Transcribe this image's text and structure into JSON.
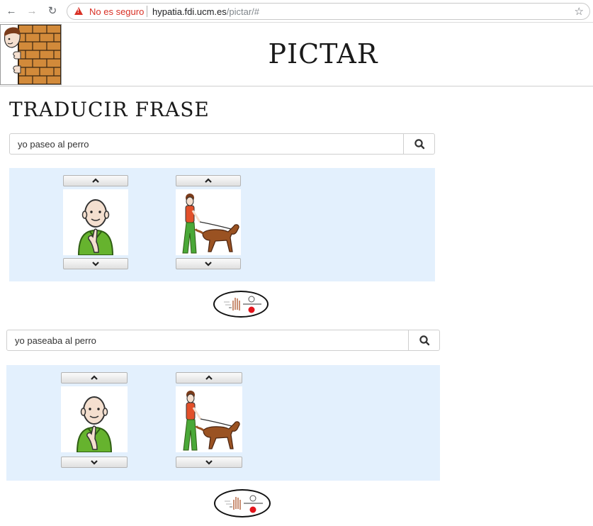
{
  "browser": {
    "security_label": "No es seguro",
    "url_host": "hypatia.fdi.ucm.es",
    "url_path": "/pictar/#",
    "back_icon": "arrow-left-icon",
    "forward_icon": "arrow-right-icon",
    "reload_icon": "reload-icon",
    "bookmark_icon": "star-icon"
  },
  "header": {
    "title": "PICTAR",
    "logo": "boy-peeking-behind-brick-wall"
  },
  "page": {
    "title": "Traducir frase"
  },
  "translations": [
    {
      "query": "yo paseo al perro",
      "pictograms": [
        {
          "concept": "yo",
          "image": "person-pointing-self"
        },
        {
          "concept": "pasear al perro",
          "image": "girl-walking-dog"
        }
      ],
      "action_icon": "sign-language-icon"
    },
    {
      "query": "yo paseaba al perro",
      "pictograms": [
        {
          "concept": "yo",
          "image": "person-pointing-self"
        },
        {
          "concept": "pasear al perro",
          "image": "girl-walking-dog"
        }
      ],
      "action_icon": "sign-language-icon"
    }
  ],
  "colors": {
    "panel_bg": "#e3f0fd",
    "insecure": "#d93025"
  }
}
